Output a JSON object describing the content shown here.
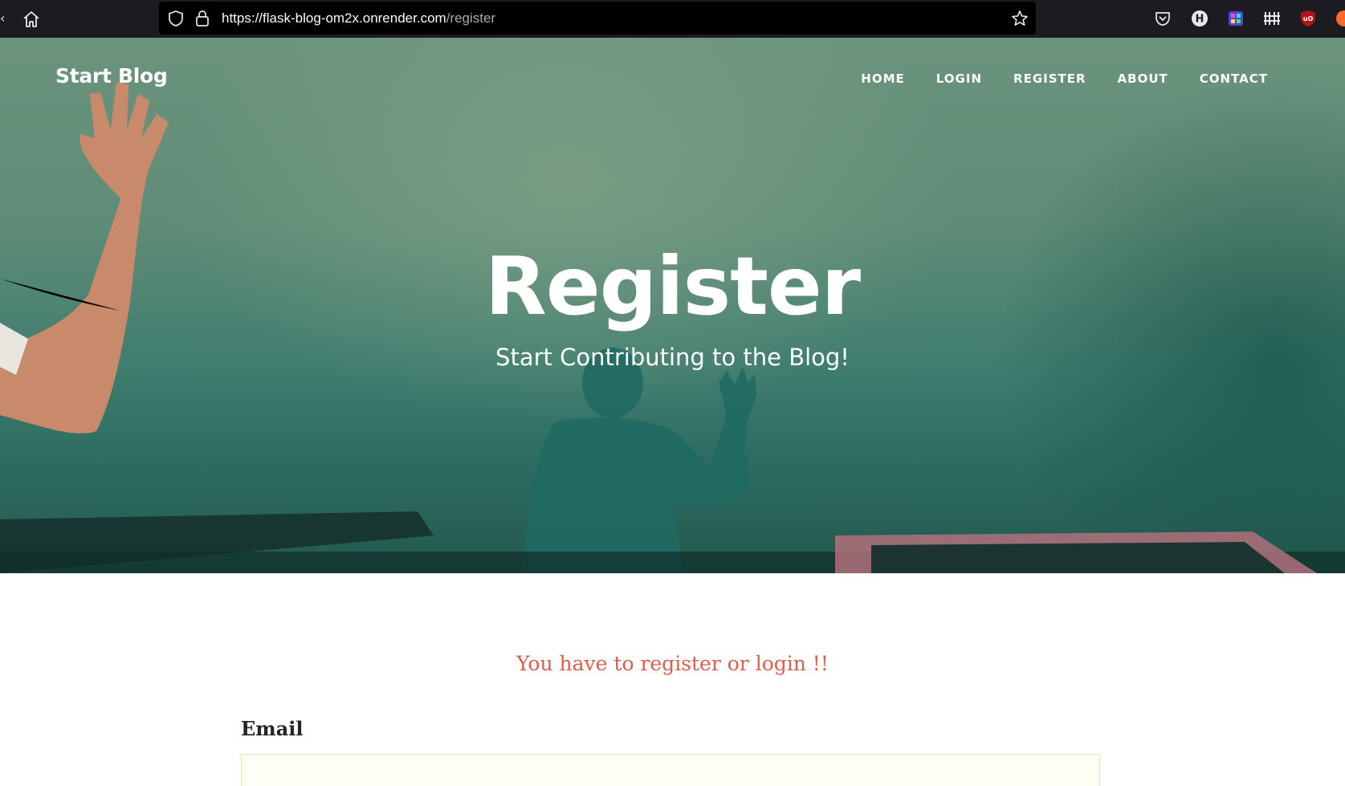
{
  "browser": {
    "url_host": "https://flask-blog-om2x.onrender.com",
    "url_path": "/register",
    "icons": [
      "back-icon",
      "home-icon",
      "shield-icon",
      "lock-icon",
      "bookmark-star-icon",
      "pocket-icon",
      "extension-h-icon",
      "extension-color-icon",
      "extension-grid-icon",
      "ublock-icon",
      "extension-orange-icon"
    ]
  },
  "site": {
    "brand": "Start Blog",
    "nav": [
      {
        "label": "HOME"
      },
      {
        "label": "LOGIN"
      },
      {
        "label": "REGISTER"
      },
      {
        "label": "ABOUT"
      },
      {
        "label": "CONTACT"
      }
    ]
  },
  "hero": {
    "title": "Register",
    "subtitle": "Start Contributing to the Blog!"
  },
  "content": {
    "flash_message": "You have to register or login !!",
    "email_label": "Email"
  },
  "colors": {
    "browser_bar": "#1c1b22",
    "urlbar": "#000000",
    "hero_green": "#5f8c77",
    "flash_red": "#e25c4b",
    "text_dark": "#212529"
  }
}
